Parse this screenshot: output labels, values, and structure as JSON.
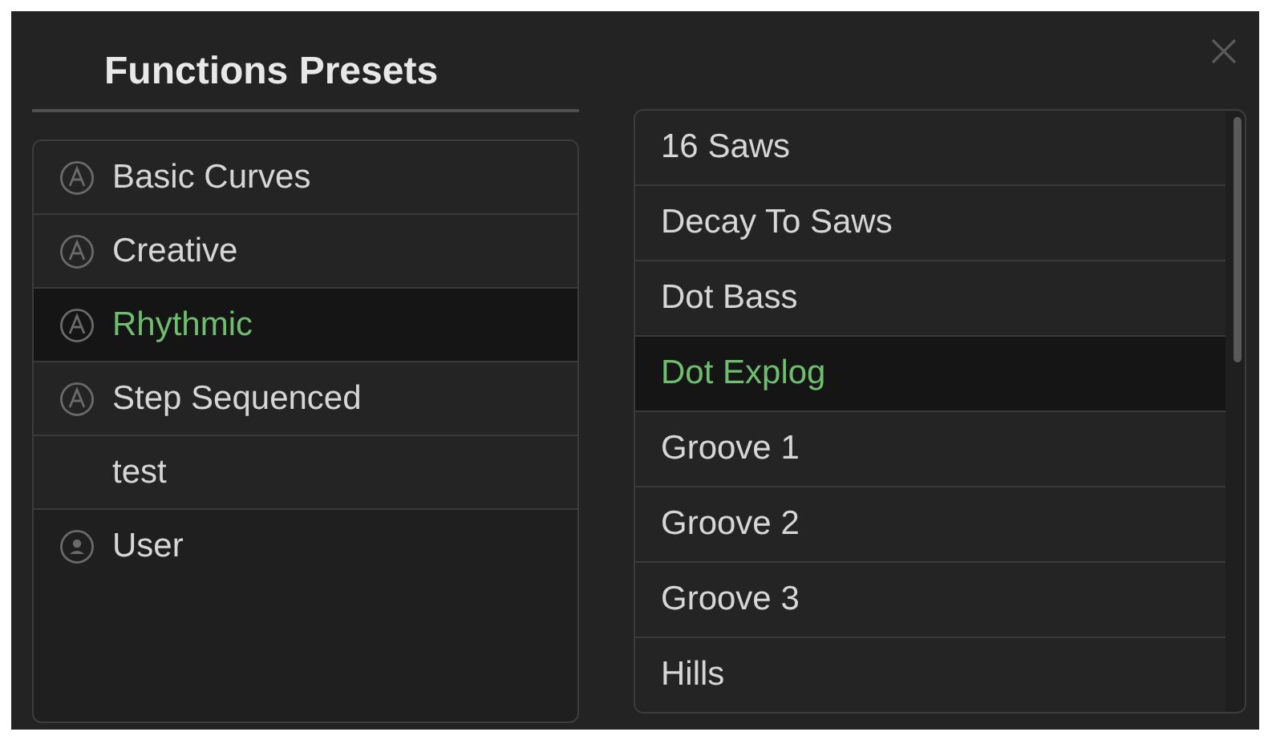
{
  "title": "Functions Presets",
  "categories": [
    {
      "label": "Basic Curves",
      "kind": "factory",
      "selected": false
    },
    {
      "label": "Creative",
      "kind": "factory",
      "selected": false
    },
    {
      "label": "Rhythmic",
      "kind": "factory",
      "selected": true
    },
    {
      "label": "Step Sequenced",
      "kind": "factory",
      "selected": false
    },
    {
      "label": "test",
      "kind": "plain",
      "selected": false
    },
    {
      "label": "User",
      "kind": "user",
      "selected": false
    }
  ],
  "presets": [
    {
      "label": "16 Saws",
      "selected": false
    },
    {
      "label": "Decay To Saws",
      "selected": false
    },
    {
      "label": "Dot Bass",
      "selected": false
    },
    {
      "label": "Dot Explog",
      "selected": true
    },
    {
      "label": "Groove 1",
      "selected": false
    },
    {
      "label": "Groove 2",
      "selected": false
    },
    {
      "label": "Groove 3",
      "selected": false
    },
    {
      "label": "Hills",
      "selected": false
    }
  ]
}
